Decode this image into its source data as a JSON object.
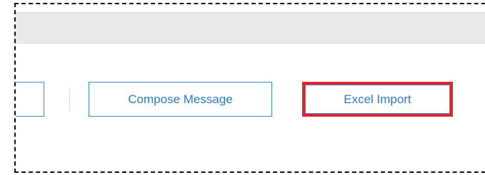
{
  "toolbar": {
    "compose_label": "Compose Message",
    "excel_import_label": "Excel Import"
  },
  "colors": {
    "accent": "#2b7bc7",
    "button_border": "#3b8fd6",
    "highlight": "#e0242e",
    "header_bar": "#e9e9e9"
  }
}
